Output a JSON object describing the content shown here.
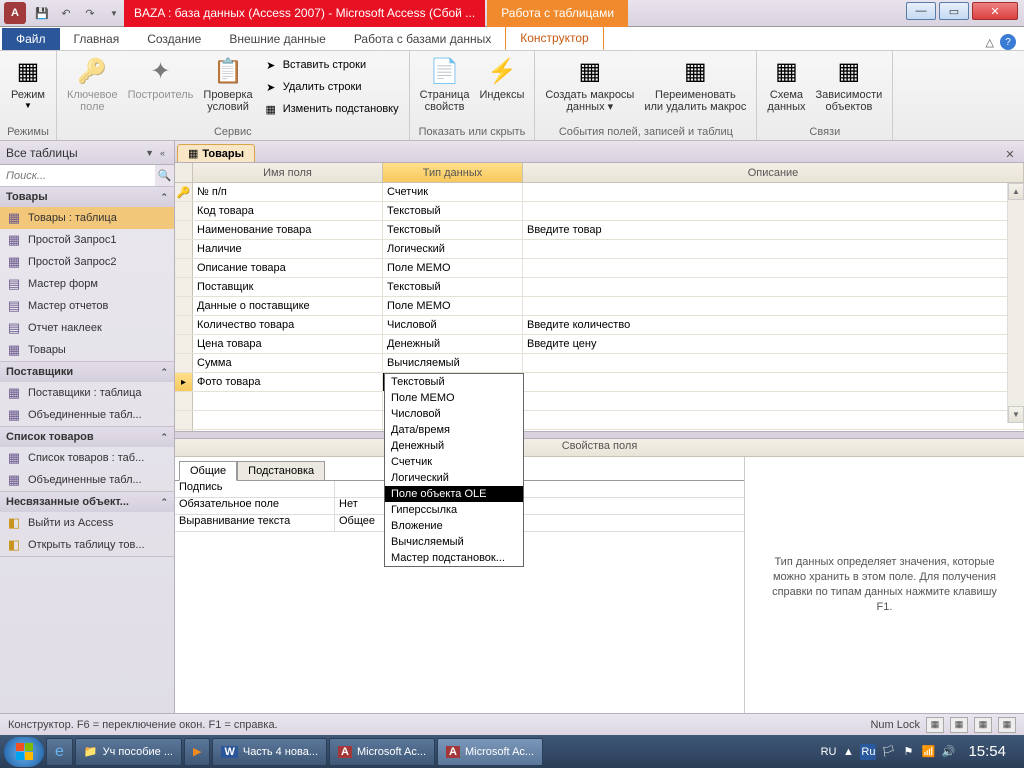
{
  "title": "BAZA : база данных (Access 2007)  -  Microsoft Access (Сбой ...",
  "context_tab": "Работа с таблицами",
  "tabs": {
    "file": "Файл",
    "t0": "Главная",
    "t1": "Создание",
    "t2": "Внешние данные",
    "t3": "Работа с базами данных",
    "t4": "Конструктор"
  },
  "ribbon": {
    "g0": {
      "label": "Режимы",
      "b0": "Режим"
    },
    "g1": {
      "label": "Сервис",
      "b0": "Ключевое\nполе",
      "b1": "Построитель",
      "b2": "Проверка\nусловий",
      "s0": "Вставить строки",
      "s1": "Удалить строки",
      "s2": "Изменить подстановку"
    },
    "g2": {
      "label": "Показать или скрыть",
      "b0": "Страница\nсвойств",
      "b1": "Индексы"
    },
    "g3": {
      "label": "События полей, записей и таблиц",
      "b0": "Создать макросы\nданных ▾",
      "b1": "Переименовать\nили удалить макрос"
    },
    "g4": {
      "label": "Связи",
      "b0": "Схема\nданных",
      "b1": "Зависимости\nобъектов"
    }
  },
  "nav": {
    "header": "Все таблицы",
    "search_ph": "Поиск...",
    "groups": [
      {
        "title": "Товары",
        "items": [
          "Товары : таблица",
          "Простой Запрос1",
          "Простой Запрос2",
          "Мастер форм",
          "Мастер отчетов",
          "Отчет наклеек",
          "Товары"
        ],
        "icons": [
          "▦",
          "▦",
          "▦",
          "▤",
          "▤",
          "▤",
          "▦"
        ]
      },
      {
        "title": "Поставщики",
        "items": [
          "Поставщики : таблица",
          "Объединенные табл..."
        ],
        "icons": [
          "▦",
          "▦"
        ]
      },
      {
        "title": "Список товаров",
        "items": [
          "Список товаров : таб...",
          "Объединенные табл..."
        ],
        "icons": [
          "▦",
          "▦"
        ]
      },
      {
        "title": "Несвязанные объект...",
        "items": [
          "Выйти из Access",
          "Открыть таблицу тов..."
        ],
        "icons": [
          "◧",
          "◧"
        ]
      }
    ]
  },
  "doc_tab": "Товары",
  "grid": {
    "h_name": "Имя поля",
    "h_type": "Тип данных",
    "h_desc": "Описание",
    "rows": [
      {
        "pk": true,
        "name": "№ п/п",
        "type": "Счетчик",
        "desc": ""
      },
      {
        "name": "Код товара",
        "type": "Текстовый",
        "desc": ""
      },
      {
        "name": "Наименование товара",
        "type": "Текстовый",
        "desc": "Введите товар"
      },
      {
        "name": "Наличие",
        "type": "Логический",
        "desc": ""
      },
      {
        "name": "Описание товара",
        "type": "Поле МЕМО",
        "desc": ""
      },
      {
        "name": "Поставщик",
        "type": "Текстовый",
        "desc": ""
      },
      {
        "name": "Данные о поставщике",
        "type": "Поле МЕМО",
        "desc": ""
      },
      {
        "name": "Количество товара",
        "type": "Числовой",
        "desc": "Введите количество"
      },
      {
        "name": "Цена товара",
        "type": "Денежный",
        "desc": "Введите цену"
      },
      {
        "name": "Сумма",
        "type": "Вычисляемый",
        "desc": ""
      },
      {
        "sel": true,
        "name": "Фото товара",
        "type": "Поле объекта OLE",
        "desc": ""
      }
    ]
  },
  "dropdown": [
    "Текстовый",
    "Поле МЕМО",
    "Числовой",
    "Дата/время",
    "Денежный",
    "Счетчик",
    "Логический",
    "Поле объекта OLE",
    "Гиперссылка",
    "Вложение",
    "Вычисляемый",
    "Мастер подстановок..."
  ],
  "dropdown_hl": 7,
  "props": {
    "header": "Свойства поля",
    "tab0": "Общие",
    "tab1": "Подстановка",
    "rows": [
      [
        "Подпись",
        ""
      ],
      [
        "Обязательное поле",
        "Нет"
      ],
      [
        "Выравнивание текста",
        "Общее"
      ]
    ],
    "help": "Тип данных определяет значения, которые можно хранить в этом поле. Для получения справки по типам данных нажмите клавишу F1."
  },
  "status": {
    "left": "Конструктор.  F6 = переключение окон.  F1 = справка.",
    "numlock": "Num Lock"
  },
  "taskbar": {
    "items": [
      "Уч пособие ...",
      "",
      "Часть 4 нова...",
      "Microsoft Ac...",
      "Microsoft Ac..."
    ],
    "lang": "RU",
    "clock": "15:54"
  }
}
